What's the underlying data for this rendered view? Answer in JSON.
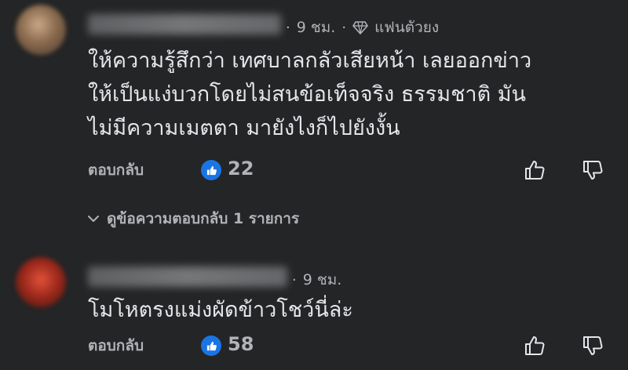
{
  "comments": [
    {
      "time": "9 ชม.",
      "badge": "แฟนตัวยง",
      "lines": [
        "ให้ความรู้สึกว่า เทศบาลกลัวเสียหน้า เลยออกข่าว",
        "ให้เป็นแง่บวกโดยไม่สนข้อเท็จจริง ธรรมชาติ มัน",
        "ไม่มีความเมตตา มายังไงก็ไปยังงั้น"
      ],
      "reply_label": "ตอบกลับ",
      "like_count": "22"
    },
    {
      "time": "9 ชม.",
      "lines": [
        "โมโหตรงแม่งผัดข้าวโชว์นี่ล่ะ"
      ],
      "reply_label": "ตอบกลับ",
      "like_count": "58"
    }
  ],
  "view_replies": "ดูข้อความตอบกลับ 1 รายการ",
  "icons": [
    "diamond-icon",
    "like-badge-icon",
    "thumb-up-icon",
    "thumb-down-icon",
    "chevron-down-icon"
  ],
  "colors": {
    "background": "#242526",
    "text": "#e4e6eb",
    "secondary": "#b0b3b8",
    "like_blue": "#1b74e4"
  }
}
